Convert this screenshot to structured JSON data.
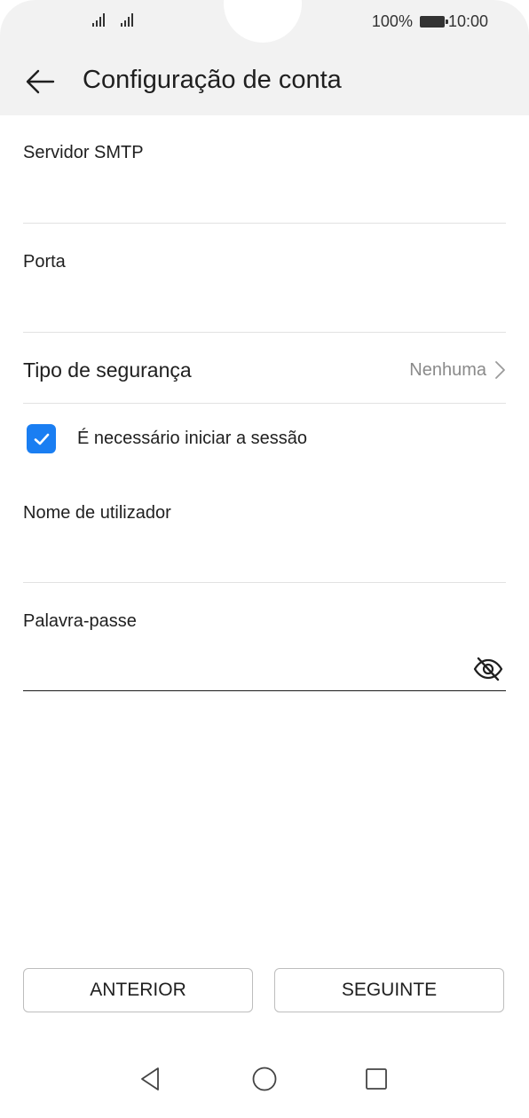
{
  "status_bar": {
    "battery_percent": "100%",
    "time": "10:00"
  },
  "header": {
    "title": "Configuração de conta",
    "back_icon": "arrow-left-icon"
  },
  "form": {
    "smtp_server": {
      "label": "Servidor SMTP",
      "value": ""
    },
    "port": {
      "label": "Porta",
      "value": ""
    },
    "security": {
      "label": "Tipo de segurança",
      "value": "Nenhuma"
    },
    "login_required": {
      "label": "É necessário iniciar a sessão",
      "checked": true
    },
    "username": {
      "label": "Nome de utilizador",
      "value": ""
    },
    "password": {
      "label": "Palavra-passe",
      "value": "",
      "toggle_icon": "eye-off-icon"
    }
  },
  "buttons": {
    "previous": "ANTERIOR",
    "next": "SEGUINTE"
  },
  "colors": {
    "accent": "#1a7ef2",
    "header_bg": "#f2f2f2",
    "secondary_text": "#8a8a8a"
  }
}
